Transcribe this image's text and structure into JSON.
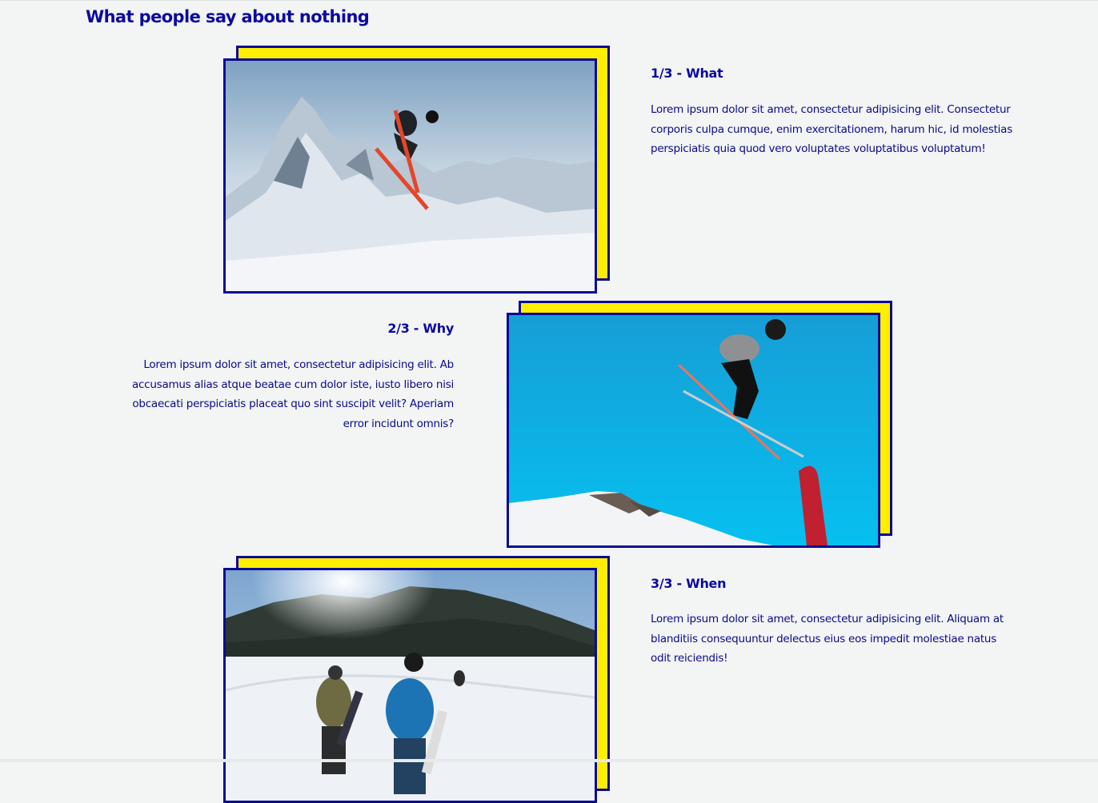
{
  "section": {
    "title": "What people say about nothing"
  },
  "testimonials": [
    {
      "heading": "1/3 - What",
      "text": "Lorem ipsum dolor sit amet, consectetur adipisicing elit. Consectetur corporis culpa cumque, enim exercitationem, harum hic, id molestias perspiciatis quia quod vero voluptates voluptatibus voluptatum!",
      "photo_icon": "skier-mountain-photo"
    },
    {
      "heading": "2/3 - Why",
      "text": "Lorem ipsum dolor sit amet, consectetur adipisicing elit. Ab accusamus alias atque beatae cum dolor iste, iusto libero nisi obcaecati perspiciatis placeat quo sint suscipit velit? Aperiam error incidunt omnis?",
      "photo_icon": "skier-blue-sky-photo"
    },
    {
      "heading": "3/3 - When",
      "text": "Lorem ipsum dolor sit amet, consectetur adipisicing elit. Aliquam at blanditiis consequuntur delectus eius eos impedit molestiae natus odit reiciendis!",
      "photo_icon": "snowboarders-slope-photo"
    }
  ],
  "colors": {
    "accent_blue": "#0a0aa0",
    "frame_yellow": "#ffee00",
    "background": "#f3f4f4"
  }
}
